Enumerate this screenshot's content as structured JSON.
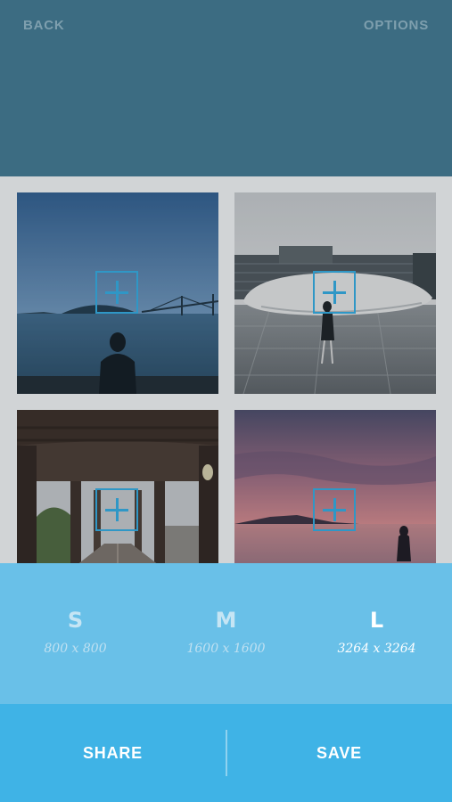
{
  "header": {
    "back_label": "BACK",
    "options_label": "OPTIONS",
    "bg_color": "#3c6c82"
  },
  "photos": [
    {
      "name": "bay-bridge-silhouette"
    },
    {
      "name": "white-pavilion-building"
    },
    {
      "name": "railway-bridge-underpass"
    },
    {
      "name": "pink-sunset-shoreline"
    }
  ],
  "sizes": {
    "options": [
      {
        "letter": "S",
        "dims": "800 x 800"
      },
      {
        "letter": "M",
        "dims": "1600 x 1600"
      },
      {
        "letter": "L",
        "dims": "3264 x 3264"
      }
    ],
    "selected": "L"
  },
  "actions": {
    "share_label": "SHARE",
    "save_label": "SAVE"
  },
  "colors": {
    "accent": "#2f97c6",
    "size_panel": "#69c0e8",
    "action_bar": "#3fb3e6"
  }
}
